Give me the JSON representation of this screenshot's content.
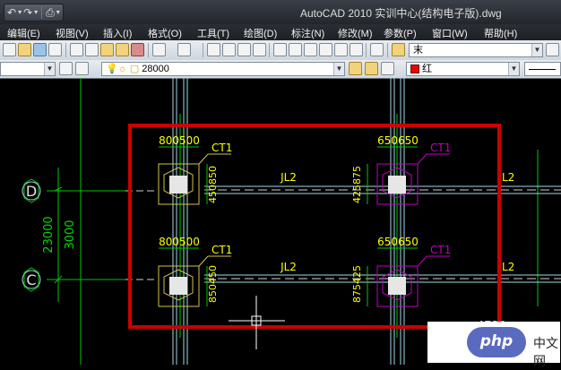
{
  "app": {
    "title": "AutoCAD 2010   实训中心(结构电子版).dwg"
  },
  "quick_access": {
    "icons": [
      "undo-icon",
      "redo-icon",
      "print-icon",
      "dropdown-icon"
    ]
  },
  "menu": {
    "items": [
      {
        "label": "编辑(E)",
        "key": "edit"
      },
      {
        "label": "视图(V)",
        "key": "view"
      },
      {
        "label": "插入(I)",
        "key": "insert"
      },
      {
        "label": "格式(O)",
        "key": "format"
      },
      {
        "label": "工具(T)",
        "key": "tools"
      },
      {
        "label": "绘图(D)",
        "key": "draw"
      },
      {
        "label": "标注(N)",
        "key": "dimension"
      },
      {
        "label": "修改(M)",
        "key": "modify"
      },
      {
        "label": "参数(P)",
        "key": "parametric"
      },
      {
        "label": "窗口(W)",
        "key": "window"
      },
      {
        "label": "帮助(H)",
        "key": "help"
      }
    ]
  },
  "toolbar": {
    "text_style": "末",
    "layer_value": "28000",
    "color_value": "红"
  },
  "drawing": {
    "colors": {
      "frame_red": "#cc0000",
      "grid_green": "#00c800",
      "beam_cyan": "#9fd9e6",
      "column_yellow": "#d2c24a",
      "column_magenta": "#c000c0",
      "text_yellow": "#ffff00",
      "text_green": "#00dd00"
    },
    "grid_labels": {
      "d": "D",
      "c": "C"
    },
    "overall_dims": {
      "outer": "23000",
      "inner": "3000"
    },
    "top_left": {
      "dim_top": "800500",
      "dim_side": "450850",
      "tag": "CT1"
    },
    "top_right": {
      "dim_top": "650650",
      "dim_side": "425875",
      "tag": "CT1"
    },
    "bottom_left": {
      "dim_top": "800500",
      "dim_side": "850450",
      "tag": "CT1"
    },
    "bottom_right": {
      "dim_top": "650650",
      "dim_side": "875425",
      "tag": "CT1"
    },
    "beams": {
      "mid_top": "JL2",
      "mid_bottom": "JL2",
      "right_top": "L2",
      "right_bottom": "L2"
    },
    "partial_text": "4730"
  },
  "watermark": {
    "logo_text": "php",
    "site_text": "中文网"
  }
}
